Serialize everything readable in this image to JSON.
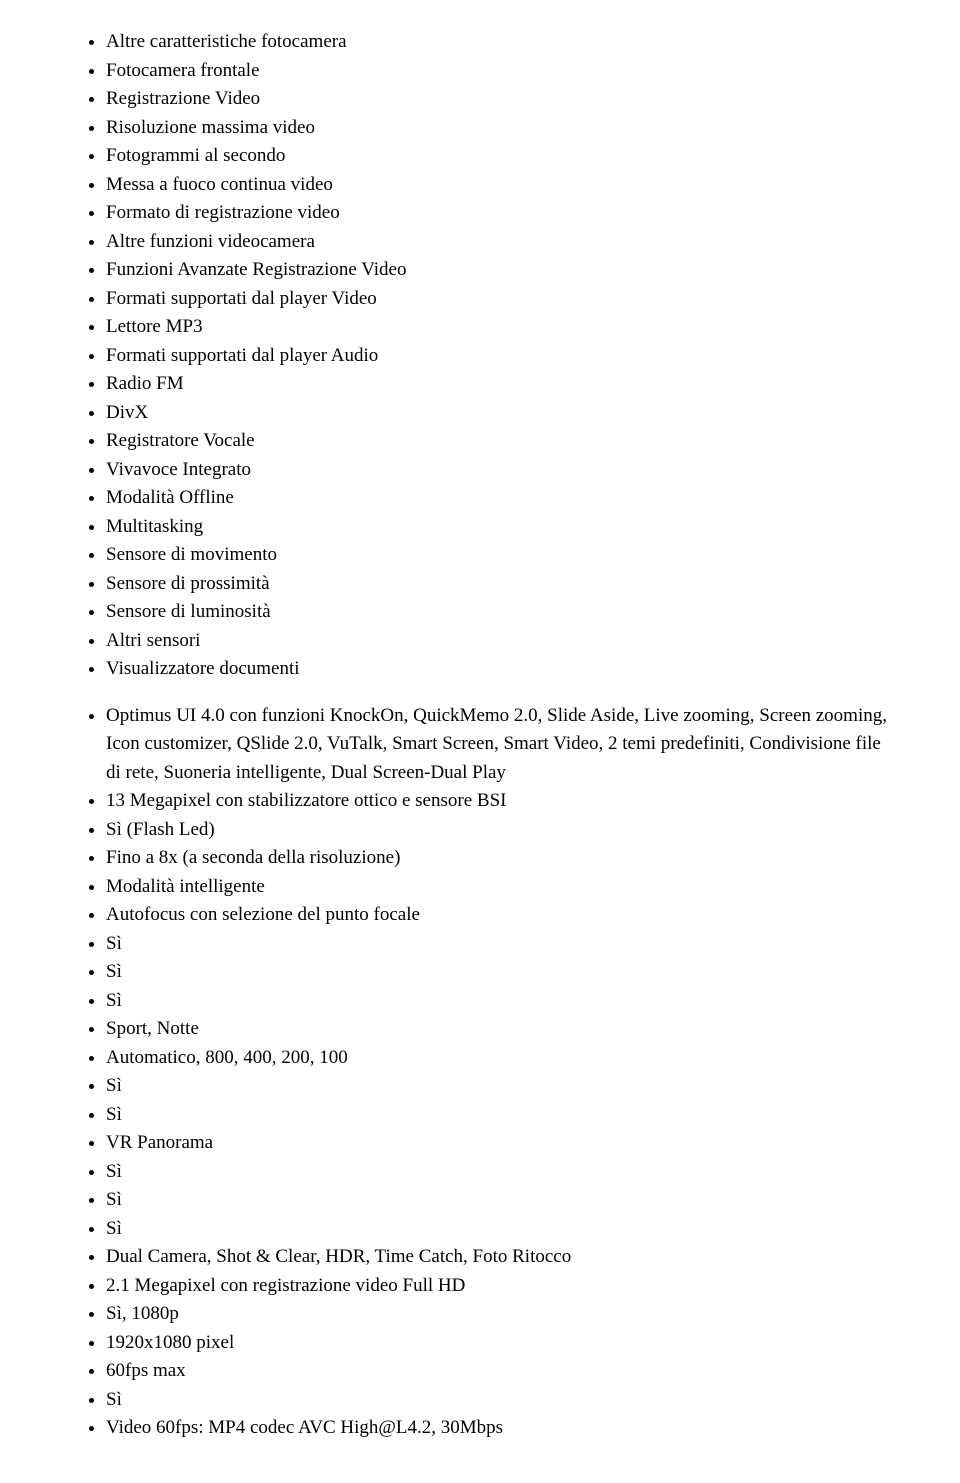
{
  "list1": [
    "Altre caratteristiche fotocamera",
    "Fotocamera frontale",
    "Registrazione Video",
    "Risoluzione massima video",
    "Fotogrammi al secondo",
    "Messa a fuoco continua video",
    "Formato di registrazione video",
    "Altre funzioni videocamera",
    "Funzioni Avanzate Registrazione Video",
    "Formati supportati dal player Video",
    "Lettore MP3",
    "Formati supportati dal player Audio",
    "Radio FM",
    "DivX",
    "Registratore Vocale",
    "Vivavoce Integrato",
    "Modalità Offline",
    "Multitasking",
    "Sensore di movimento",
    "Sensore di prossimità",
    "Sensore di luminosità",
    "Altri sensori",
    "Visualizzatore documenti"
  ],
  "list2": [
    "Optimus UI 4.0 con funzioni KnockOn, QuickMemo 2.0, Slide Aside, Live zooming, Screen zooming, Icon customizer, QSlide 2.0, VuTalk, Smart Screen, Smart Video, 2 temi predefiniti, Condivisione file di rete, Suoneria intelligente, Dual Screen-Dual Play",
    "13 Megapixel con stabilizzatore ottico e sensore BSI",
    "Sì (Flash Led)",
    "Fino a 8x (a seconda della risoluzione)",
    "Modalità intelligente",
    "Autofocus con selezione del punto focale",
    "Sì",
    "Sì",
    "Sì",
    "Sport, Notte",
    "Automatico, 800, 400, 200, 100",
    "Sì",
    "Sì",
    "VR Panorama",
    "Sì",
    "Sì",
    "Sì",
    "Dual Camera, Shot & Clear, HDR, Time Catch, Foto Ritocco",
    "2.1 Megapixel con registrazione video Full HD",
    "Sì, 1080p",
    "1920x1080 pixel",
    "60fps max",
    "Sì",
    "Video 60fps: MP4 codec AVC High@L4.2, 30Mbps"
  ]
}
